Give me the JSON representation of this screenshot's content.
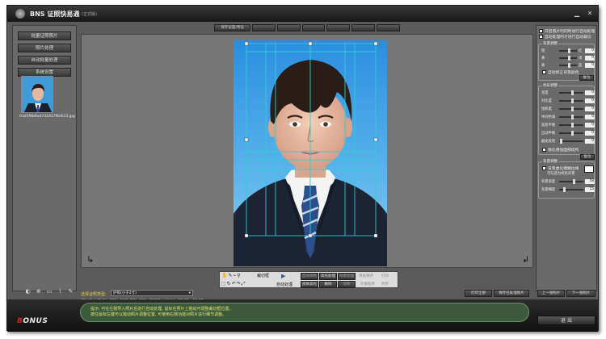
{
  "window": {
    "title": "BNS 证照快易通",
    "version": "(正式版)"
  },
  "left": {
    "buttons": [
      "批量证照照片",
      "照片处理",
      "自动批量处理",
      "系统设置"
    ],
    "thumbnail_caption": "0.bf2f9b8a47d1817f6e613.jpg"
  },
  "top_toolbar": [
    "保存设置/预设",
    "",
    "",
    "",
    "",
    "",
    "",
    ""
  ],
  "right": {
    "checks": [
      {
        "label": "开启照片时同时进行自动处理",
        "on": false
      },
      {
        "label": "自动处理时才进行自动裁切",
        "on": true
      }
    ],
    "group1_title": "背景调整",
    "group1_sliders": [
      {
        "name": "红",
        "left": "暗",
        "right": "红",
        "value": "0"
      },
      {
        "name": "绿",
        "left": "黄",
        "right": "绿",
        "value": "0"
      },
      {
        "name": "蓝",
        "left": "黄",
        "right": "蓝",
        "value": "0"
      }
    ],
    "group1_check": "自动修正背景颜色",
    "group1_reset": "复位",
    "group2_title": "色彩调整",
    "group2_sliders": [
      {
        "name": "亮度",
        "value": "0"
      },
      {
        "name": "对比度",
        "value": "0"
      },
      {
        "name": "饱和度",
        "value": "0"
      },
      {
        "name": "中间色调",
        "value": "0"
      },
      {
        "name": "高反平衡",
        "value": "0"
      },
      {
        "name": "自动平衡",
        "value": "0"
      },
      {
        "name": "磨皮处理",
        "value": "0"
      }
    ],
    "group2_check": "锐化增强面部结构",
    "group2_reset": "复位",
    "group3_title": "背景调整",
    "group3_check": "背景虚化模糊边缘",
    "group3_sub": "可勾选为纯色背景",
    "group3_sliders": [
      {
        "name": "背景宽度",
        "value": "58"
      },
      {
        "name": "背景细度",
        "value": "15"
      }
    ]
  },
  "bottom_left": {
    "select_label": "选择证照类型:",
    "select_value": "护照(小于2寸)",
    "size_info": "相片尺寸(像素): 390×567, DPI: 300, 打印尺寸(毫米): 33.00×48.00"
  },
  "mid_toolbar": {
    "crop": "裁切框",
    "auto": "自动处理",
    "row1": [
      "自动调色",
      "高光处理",
      "背景处理"
    ],
    "row2": [
      "皮肤美化",
      "删除",
      "镜像"
    ],
    "single": "单张保存",
    "print": "打印",
    "extra1": "外部程序",
    "extra2": "另存"
  },
  "bottom_buttons": {
    "print": "打印全部",
    "save_all": "保存已处理照片",
    "prev": "上一张照片",
    "next": "下一张照片"
  },
  "footer": {
    "brand_b": "B",
    "brand_rest": "ONUS",
    "message_line1": "提示: 可在左侧导入照片后进行自动处理, 鼠标在照片上拖动可调整裁切框位置。",
    "message_line2": "   按住鼠标左键可以拖动照片调整位置, 可使用右侧功能对照片进行细节调整。",
    "exit": "退  出"
  },
  "colors": {
    "accent": "#5a5a5a",
    "message_bg": "#3c5a3c",
    "message_text": "#e8e070",
    "crop_line": "#2bd0d0"
  }
}
